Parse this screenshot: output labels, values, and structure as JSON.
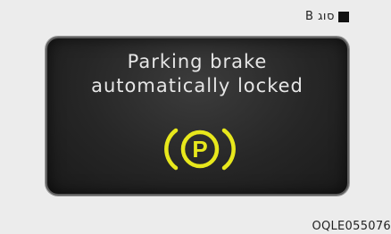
{
  "type_label": {
    "text": "B סוג",
    "icon": "square-icon"
  },
  "display": {
    "message_line_1": "Parking brake",
    "message_line_2": "automatically locked",
    "icon": "parking-brake-icon",
    "icon_letter": "P",
    "icon_color": "#e8e81c",
    "panel_color": "#2a2a2a",
    "text_color": "#e6e6e6"
  },
  "figure_code": "OQLE055076"
}
